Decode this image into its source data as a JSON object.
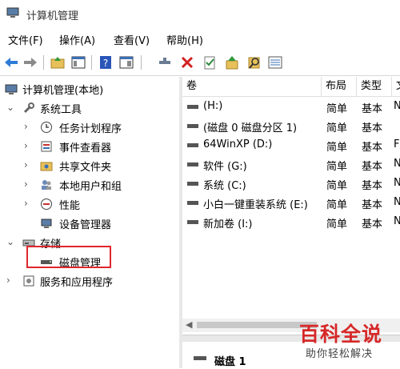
{
  "window": {
    "title": "计算机管理"
  },
  "menu": [
    "文件(F)",
    "操作(A)",
    "查看(V)",
    "帮助(H)"
  ],
  "toolbar_icons": [
    "back-arrow-icon",
    "forward-arrow-icon",
    "folder-up-icon",
    "show-hide-tree-icon",
    "help-icon",
    "properties-icon",
    "connect-icon",
    "delete-icon",
    "checkmark-icon",
    "up-icon",
    "search-icon",
    "list-icon"
  ],
  "tree": {
    "root": "计算机管理(本地)",
    "system_tools": "系统工具",
    "task_scheduler": "任务计划程序",
    "event_viewer": "事件查看器",
    "shared_folders": "共享文件夹",
    "local_users": "本地用户和组",
    "performance": "性能",
    "device_manager": "设备管理器",
    "storage": "存储",
    "disk_management": "磁盘管理",
    "services": "服务和应用程序"
  },
  "table": {
    "columns": [
      "卷",
      "布局",
      "类型",
      "文"
    ],
    "rows": [
      {
        "vol": "(H:)",
        "layout": "简单",
        "type": "基本",
        "fs": "N"
      },
      {
        "vol": "(磁盘 0 磁盘分区 1)",
        "layout": "简单",
        "type": "基本",
        "fs": ""
      },
      {
        "vol": "64WinXP  (D:)",
        "layout": "简单",
        "type": "基本",
        "fs": "F"
      },
      {
        "vol": "软件 (G:)",
        "layout": "简单",
        "type": "基本",
        "fs": "N"
      },
      {
        "vol": "系统 (C:)",
        "layout": "简单",
        "type": "基本",
        "fs": "N"
      },
      {
        "vol": "小白一键重装系统 (E:)",
        "layout": "简单",
        "type": "基本",
        "fs": "N"
      },
      {
        "vol": "新加卷 (I:)",
        "layout": "简单",
        "type": "基本",
        "fs": "N"
      }
    ]
  },
  "bottom": {
    "disk_label": "磁盘 1"
  },
  "watermark": {
    "line1": "百科全说",
    "line2": "助你轻松解决"
  },
  "colors": {
    "highlight": "#e0262d",
    "watermark": "#d62828"
  }
}
